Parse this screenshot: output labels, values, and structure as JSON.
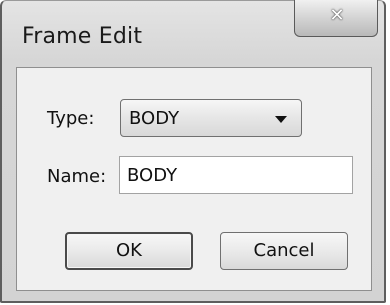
{
  "window": {
    "title": "Frame Edit",
    "close_icon": "close-icon"
  },
  "form": {
    "type_label": "Type:",
    "type_value": "BODY",
    "name_label": "Name:",
    "name_value": "BODY"
  },
  "buttons": {
    "ok": "OK",
    "cancel": "Cancel"
  },
  "colors": {
    "frame": "#5e5e5e",
    "panel": "#f0f0f0"
  }
}
